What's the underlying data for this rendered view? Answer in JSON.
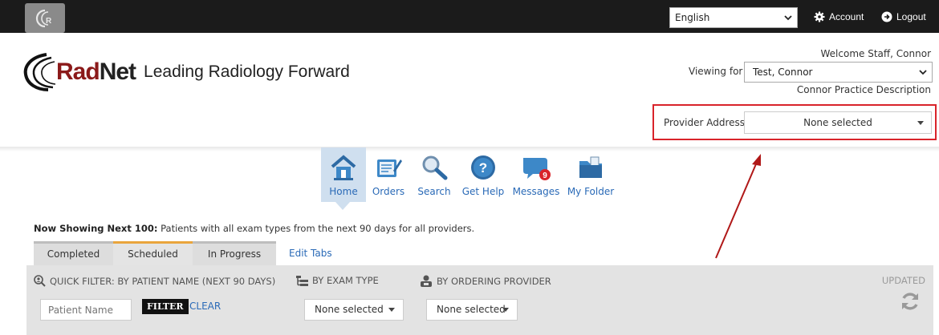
{
  "topbar": {
    "language": "English",
    "account_label": "Account",
    "logout_label": "Logout"
  },
  "brand": {
    "rad": "Rad",
    "net": "Net",
    "tagline": "Leading Radiology Forward"
  },
  "header": {
    "welcome": "Welcome Staff, Connor",
    "viewing_label": "Viewing for",
    "viewing_value": "Test, Connor",
    "practice_desc": "Connor Practice Description",
    "provider_address_label": "Provider Address",
    "provider_address_value": "None selected"
  },
  "nav": {
    "items": [
      {
        "label": "Home",
        "icon": "home-icon"
      },
      {
        "label": "Orders",
        "icon": "orders-icon"
      },
      {
        "label": "Search",
        "icon": "search-icon"
      },
      {
        "label": "Get Help",
        "icon": "help-icon"
      },
      {
        "label": "Messages",
        "icon": "messages-icon",
        "badge": "9"
      },
      {
        "label": "My Folder",
        "icon": "folder-icon"
      }
    ]
  },
  "now_showing": {
    "label": "Now Showing Next 100:",
    "text": " Patients with all exam types from the next 90 days for all providers."
  },
  "tabs": {
    "items": [
      "Completed",
      "Scheduled",
      "In Progress"
    ],
    "edit": "Edit Tabs"
  },
  "filters": {
    "quick_filter_label": "QUICK FILTER: BY PATIENT NAME (NEXT 90 DAYS)",
    "exam_type_label": "BY EXAM TYPE",
    "ordering_provider_label": "BY ORDERING PROVIDER",
    "updated_label": "UPDATED",
    "patient_placeholder": "Patient Name",
    "filter_button": "FILTER",
    "clear_link": "CLEAR",
    "exam_type_value": "None selected",
    "ordering_provider_value": "None selected"
  },
  "colors": {
    "topbar": "#1b1b1b",
    "brand_red": "#8b1a1a",
    "link_blue": "#2a6ab7",
    "highlight_red": "#d9232a"
  }
}
